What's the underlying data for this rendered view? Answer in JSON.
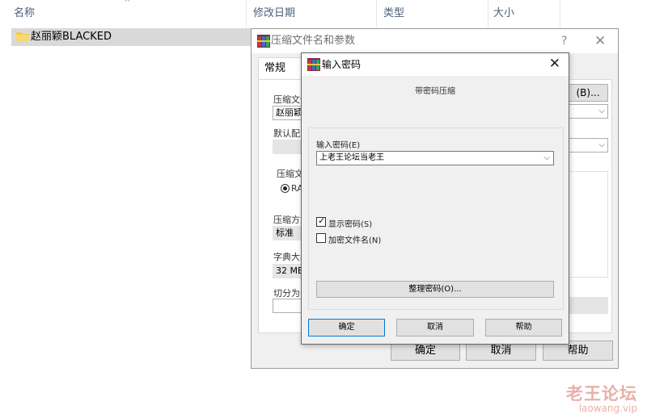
{
  "explorer": {
    "columns": [
      "名称",
      "修改日期",
      "类型",
      "大小"
    ],
    "sort_indicator": "^",
    "file": {
      "name": "赵丽颖BLACKED",
      "icon": "folder-icon"
    }
  },
  "archive_dialog": {
    "title": "压缩文件名和参数",
    "help_glyph": "?",
    "close_glyph": "✕",
    "tab": "常规",
    "labels": {
      "archive_name": "压缩文件",
      "default_profile": "默认配置",
      "archive_format": "压缩文",
      "method": "压缩方式",
      "dict_size": "字典大小",
      "split": "切分为分"
    },
    "values": {
      "archive_name": "赵丽颖",
      "format_option": "RA",
      "method": "标准",
      "dict_size": "32 MB"
    },
    "browse_button": "(B)...",
    "ok_button": "确定",
    "cancel_button": "取消",
    "help_button": "帮助"
  },
  "password_dialog": {
    "title": "输入密码",
    "close_glyph": "✕",
    "subtitle": "带密码压缩",
    "enter_password_label": "输入密码(E)",
    "password_value": "上老王论坛当老王",
    "show_password_label": "显示密码(S)",
    "show_password_checked": true,
    "encrypt_names_label": "加密文件名(N)",
    "encrypt_names_checked": false,
    "organize_button": "整理密码(O)...",
    "ok_button": "确定",
    "cancel_button": "取消",
    "help_button": "帮助"
  },
  "watermark": {
    "cn": "老王论坛",
    "en": "laowang.vip"
  },
  "colors": {
    "accent": "#0078d7",
    "watermark": "#e7b1a9",
    "header_text": "#4c607a"
  }
}
